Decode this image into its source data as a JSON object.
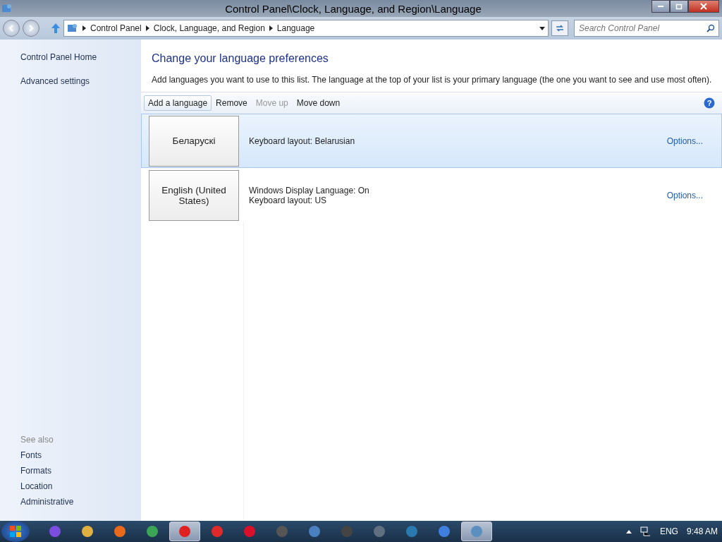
{
  "window": {
    "title": "Control Panel\\Clock, Language, and Region\\Language"
  },
  "address_bar": {
    "breadcrumbs": [
      "Control Panel",
      "Clock, Language, and Region",
      "Language"
    ],
    "search": {
      "placeholder": "Search Control Panel"
    }
  },
  "sidebar": {
    "links": [
      "Control Panel Home",
      "Advanced settings"
    ],
    "see_also": {
      "heading": "See also",
      "links": [
        "Fonts",
        "Formats",
        "Location",
        "Administrative"
      ]
    }
  },
  "content": {
    "heading": "Change your language preferences",
    "description": "Add languages you want to use to this list. The language at the top of your list is your primary language (the one you want to see and use most often).",
    "help": "?",
    "toolbar": [
      {
        "label": "Add a language",
        "disabled": false,
        "hovered": true
      },
      {
        "label": "Remove",
        "disabled": false,
        "hovered": false
      },
      {
        "label": "Move up",
        "disabled": true,
        "hovered": false
      },
      {
        "label": "Move down",
        "disabled": false,
        "hovered": false
      }
    ],
    "languages": [
      {
        "name": "Беларускі",
        "details": [
          "Keyboard layout: Belarusian"
        ],
        "options": "Options...",
        "selected": true
      },
      {
        "name": "English (United States)",
        "details": [
          "Windows Display Language: On",
          "Keyboard layout: US"
        ],
        "options": "Options...",
        "selected": false
      }
    ]
  },
  "taskbar": {
    "apps": [
      {
        "color": "#7b4de0",
        "selected": false
      },
      {
        "color": "#e0b040",
        "selected": false
      },
      {
        "color": "#e86a1a",
        "selected": false
      },
      {
        "color": "#3aa655",
        "selected": false
      },
      {
        "color": "#e02020",
        "selected": true
      },
      {
        "color": "#e02a2a",
        "selected": false
      },
      {
        "color": "#d8102a",
        "selected": false
      },
      {
        "color": "#555555",
        "selected": false
      },
      {
        "color": "#4a7fc0",
        "selected": false
      },
      {
        "color": "#444444",
        "selected": false
      },
      {
        "color": "#607080",
        "selected": false
      },
      {
        "color": "#2a7ab0",
        "selected": false
      },
      {
        "color": "#3f7fe0",
        "selected": false
      },
      {
        "color": "#5a8fc0",
        "selected": true
      }
    ],
    "language": "ENG",
    "time": "9:48 AM"
  }
}
